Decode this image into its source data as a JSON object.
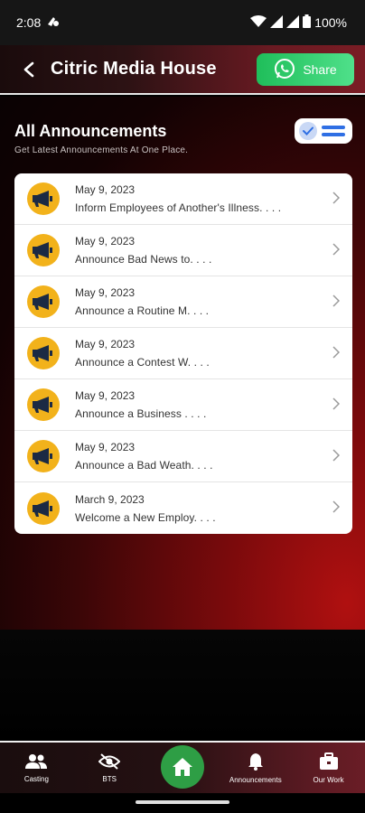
{
  "status_bar": {
    "time": "2:08",
    "battery": "100%"
  },
  "app_bar": {
    "title": "Citric Media House",
    "share_label": "Share"
  },
  "section": {
    "title": "All Announcements",
    "subtitle": "Get Latest Announcements At One Place."
  },
  "announcements": [
    {
      "date": "May 9, 2023",
      "title": "Inform Employees of Another's Illness. . . ."
    },
    {
      "date": "May 9, 2023",
      "title": "Announce Bad News to. . . ."
    },
    {
      "date": "May 9, 2023",
      "title": "Announce a Routine M. . . ."
    },
    {
      "date": "May 9, 2023",
      "title": "Announce a Contest W. . . ."
    },
    {
      "date": "May 9, 2023",
      "title": "Announce a Business . . . ."
    },
    {
      "date": "May 9, 2023",
      "title": "Announce a Bad Weath. . . ."
    },
    {
      "date": "March 9, 2023",
      "title": "Welcome a New Employ. . . ."
    }
  ],
  "bottom_nav": {
    "casting": "Casting",
    "bts": "BTS",
    "announcements": "Announcements",
    "our_work": "Our Work"
  },
  "colors": {
    "share_green": "#25d366",
    "home_green": "#2e9e45",
    "megaphone_yellow": "#f2b21b",
    "toggle_blue": "#2f6fe4"
  }
}
